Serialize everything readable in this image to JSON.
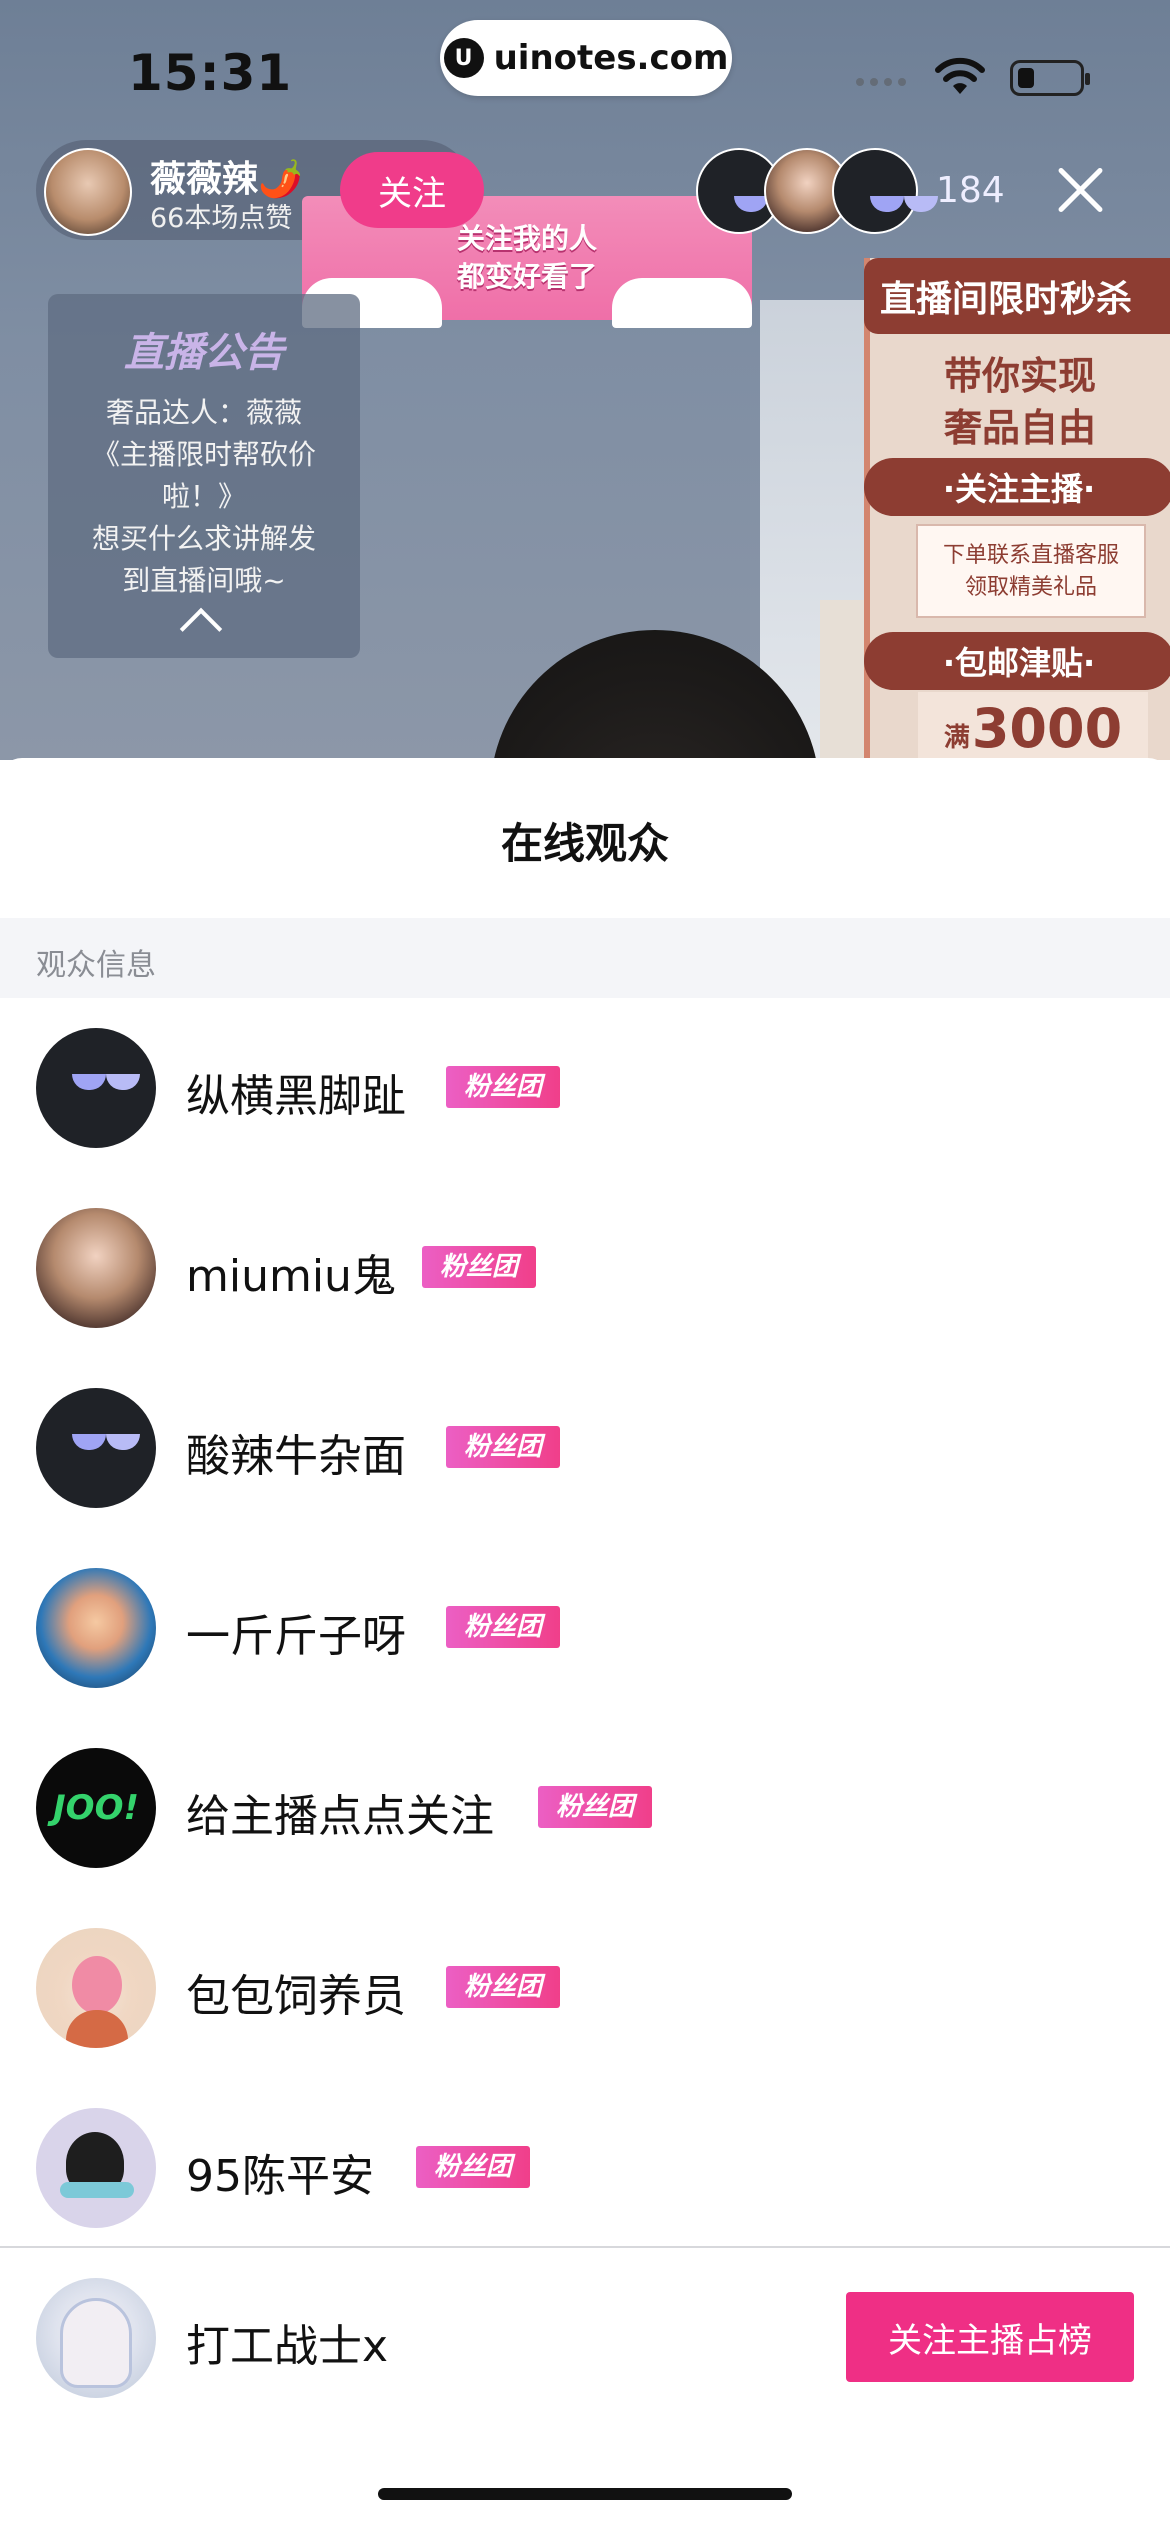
{
  "status_bar": {
    "time": "15:31",
    "url": "uinotes.com"
  },
  "live": {
    "streamer_name": "薇薇辣🌶️",
    "streamer_likes": "66本场点赞",
    "follow_label": "关注",
    "follow_banner": "关注我的人\n都变好看了",
    "viewer_count": "184",
    "announcement": {
      "title": "直播公告",
      "body": "奢品达人：薇薇\n《主播限时帮砍价\n啦！》\n想买什么求讲解发\n到直播间哦~"
    },
    "promo": {
      "header": "直播间限时秒杀",
      "subtitle": "带你实现\n奢品自由",
      "pill_follow": "·关注主播·",
      "note": "下单联系直播客服\n领取精美礼品",
      "pill_shipping": "·包邮津贴·",
      "price_prefix": "满",
      "price": "3000"
    }
  },
  "sheet": {
    "title": "在线观众",
    "section_label": "观众信息",
    "fan_badge_label": "粉丝团",
    "viewers": [
      {
        "name": "纵横黑脚趾",
        "avatar": "glasses-avatar"
      },
      {
        "name": "miumiu鬼",
        "avatar": "woman-avatar"
      },
      {
        "name": "酸辣牛杂面",
        "avatar": "glasses-avatar"
      },
      {
        "name": "一斤斤子呀",
        "avatar": "clown-avatar"
      },
      {
        "name": "给主播点点关注",
        "avatar": "joo-avatar",
        "avatar_text": "JOO!"
      },
      {
        "name": "包包饲养员",
        "avatar": "cartoon-avatar"
      },
      {
        "name": "95陈平安",
        "avatar": "seal-avatar"
      }
    ],
    "self": {
      "name": "打工战士x",
      "action_label": "关注主播占榜"
    }
  },
  "colors": {
    "accent": "#ef2f85",
    "badge_start": "#ec5fc4",
    "badge_end": "#f03f8a"
  }
}
